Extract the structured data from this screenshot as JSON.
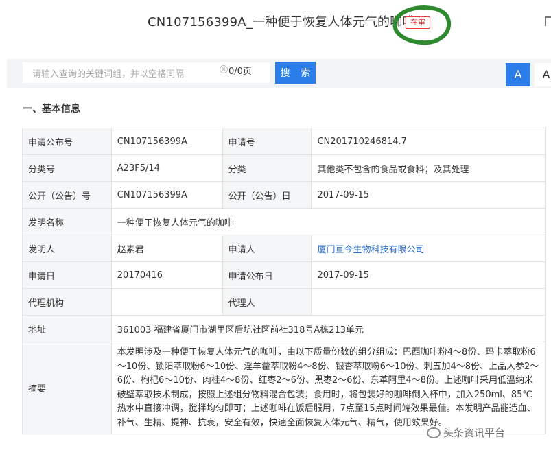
{
  "header": {
    "title": "CN107156399A_一种便于恢复人体元气的咖啡",
    "status": "在审",
    "highlight_color": "#2f8a2f"
  },
  "search": {
    "placeholder": "请输入查询的关键词组，并以空格间隔",
    "page_count": "0/0页",
    "button_label": "搜 索",
    "font_size_buttons": [
      "A",
      "A"
    ]
  },
  "section": {
    "title": "一、基本信息"
  },
  "info": {
    "rows": [
      {
        "l1": "申请公布号",
        "v1": "CN107156399A",
        "l2": "申请号",
        "v2": "CN201710246814.7"
      },
      {
        "l1": "分类号",
        "v1": "A23F5/14",
        "l2": "分类",
        "v2": "其他类不包含的食品或食料；及其处理"
      },
      {
        "l1": "公开（公告）号",
        "v1": "CN107156399A",
        "l2": "公开（公告）日",
        "v2": "2017-09-15"
      },
      {
        "l1": "发明名称",
        "v1": "一种便于恢复人体元气的咖啡"
      },
      {
        "l1": "发明人",
        "v1": "赵素君",
        "l2": "申请人",
        "v2": "厦门亘今生物科技有限公司"
      },
      {
        "l1": "申请日",
        "v1": "20170416",
        "l2": "申请公布日",
        "v2": "2017-09-15"
      },
      {
        "l1": "代理机构",
        "v1": "",
        "l2": "代理人",
        "v2": ""
      },
      {
        "l1": "地址",
        "v1": "361003 福建省厦门市湖里区后坑社区前社318号A栋213单元"
      },
      {
        "l1": "摘要",
        "v1": "本发明涉及一种便于恢复人体元气的咖啡，由以下质量份数的组分组成：巴西咖啡粉4～8份、玛卡萃取粉6～10份、锁阳萃取粉6～10份、淫羊藿萃取粉4～8份、银杏萃取粉6～10份、刺五加4～8份、上品人参2～6份、枸杞6～10份、肉桂4～8份、红枣2～6份、黑枣2～6份、东革阿里4～8份。上述咖啡采用低温纳米破壁萃取技术制成，按照上述组分物料混合包装；食用时，将包装好的咖啡倒入杯中，加入250ml、85℃热水中直接冲调，搅拌均匀即可；上述咖啡在饭后服用，7点至15点时间端效果最佳。本发明产品能造血、补气、生精、提神、抗衰，安全有效，快速全面恢复人体元气、精气，使用效果好。"
      }
    ]
  },
  "watermark": {
    "text": "头条资讯平台"
  }
}
